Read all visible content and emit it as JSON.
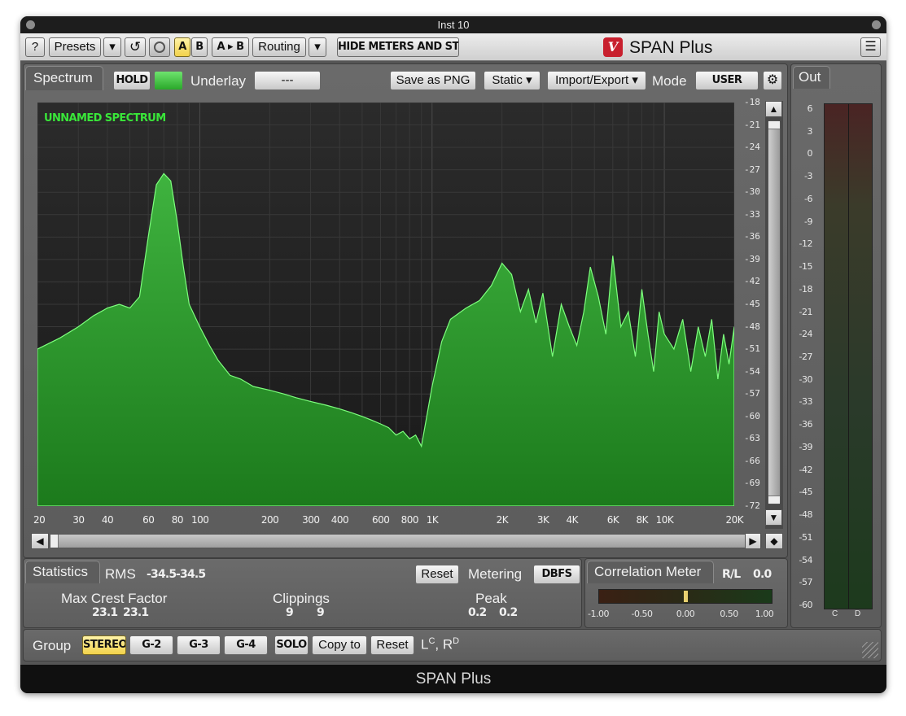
{
  "window": {
    "title": "Inst 10",
    "footer": "SPAN Plus"
  },
  "toolbar": {
    "help": "?",
    "presets": "Presets",
    "dropdown_arrow": "▾",
    "undo": "↺",
    "a": "A",
    "b": "B",
    "a_to_b": "A ▸ B",
    "routing": "Routing",
    "hide_meters": "HIDE METERS AND STATS",
    "brand_logo": "V",
    "brand": "SPAN Plus",
    "menu": "☰"
  },
  "spectrum": {
    "tab": "Spectrum",
    "hold": "HOLD",
    "underlay_label": "Underlay",
    "underlay_value": "---",
    "save_png": "Save as PNG",
    "static": "Static ▾",
    "import_export": "Import/Export ▾",
    "mode_label": "Mode",
    "mode_value": "USER",
    "settings_icon": "⚙",
    "spectrum_name": "UNNAMED SPECTRUM",
    "scroll_up": "▲",
    "scroll_down": "▼",
    "scroll_left": "◀",
    "scroll_right": "▶",
    "scroll_reset": "◆"
  },
  "chart_data": {
    "type": "area",
    "title": "",
    "xlabel": "",
    "ylabel": "",
    "x_scale": "log",
    "xlim": [
      20,
      20000
    ],
    "ylim": [
      -72,
      -18
    ],
    "grid": true,
    "color": "#2f9e2f",
    "x_ticks": [
      "20",
      "30",
      "40",
      "60",
      "80",
      "100",
      "200",
      "300",
      "400",
      "600",
      "800",
      "1K",
      "2K",
      "3K",
      "4K",
      "6K",
      "8K",
      "10K",
      "20K"
    ],
    "y_ticks": [
      "-18",
      "-21",
      "-24",
      "-27",
      "-30",
      "-33",
      "-36",
      "-39",
      "-42",
      "-45",
      "-48",
      "-51",
      "-54",
      "-57",
      "-60",
      "-63",
      "-66",
      "-69",
      "-72"
    ],
    "series": [
      {
        "values_x": [
          20,
          25,
          30,
          35,
          40,
          45,
          50,
          55,
          60,
          65,
          70,
          75,
          80,
          85,
          90,
          100,
          110,
          120,
          135,
          150,
          170,
          200,
          230,
          260,
          300,
          350,
          400,
          450,
          500,
          550,
          600,
          650,
          700,
          750,
          800,
          850,
          900,
          1000,
          1100,
          1200,
          1400,
          1600,
          1800,
          2000,
          2200,
          2400,
          2600,
          2800,
          3000,
          3300,
          3600,
          3900,
          4200,
          4500,
          4800,
          5200,
          5600,
          6000,
          6500,
          7000,
          7500,
          8000,
          8500,
          9000,
          9500,
          10000,
          11000,
          12000,
          13000,
          14000,
          15000,
          16000,
          17000,
          18000,
          19000,
          20000
        ],
        "values": [
          -51,
          -49.5,
          -48,
          -46.5,
          -45.5,
          -45,
          -45.5,
          -44,
          -36,
          -29,
          -27.5,
          -28.5,
          -34,
          -40,
          -45,
          -48,
          -50.5,
          -52.5,
          -54.5,
          -55,
          -56,
          -56.5,
          -57,
          -57.5,
          -58,
          -58.5,
          -59,
          -59.5,
          -60,
          -60.5,
          -61,
          -61.5,
          -62.5,
          -62,
          -63,
          -62.5,
          -64,
          -56,
          -50,
          -47,
          -45.5,
          -44.5,
          -42.5,
          -39.5,
          -41,
          -46,
          -43,
          -47.5,
          -43.5,
          -52,
          -45,
          -48,
          -50.5,
          -46,
          -40,
          -44,
          -49,
          -38.5,
          -48,
          -46,
          -52,
          -43,
          -49,
          -54,
          -46,
          -49,
          -51,
          -47,
          -54,
          -48,
          -52,
          -47,
          -55,
          -49,
          -53,
          -48
        ]
      }
    ]
  },
  "statistics": {
    "tab": "Statistics",
    "rms_label": "RMS",
    "rms_l": "-34.5",
    "rms_r": "-34.5",
    "reset": "Reset",
    "metering_label": "Metering",
    "metering_value": "DBFS",
    "crest_label": "Max Crest Factor",
    "crest_l": "23.1",
    "crest_r": "23.1",
    "clip_label": "Clippings",
    "clip_l": "9",
    "clip_r": "9",
    "peak_label": "Peak",
    "peak_l": "0.2",
    "peak_r": "0.2"
  },
  "correlation": {
    "tab": "Correlation Meter",
    "channel": "R/L",
    "value": "0.0",
    "level": 0.0,
    "ticks": [
      "-1.00",
      "-0.50",
      "0.00",
      "0.50",
      "1.00"
    ]
  },
  "out": {
    "tab": "Out",
    "scale": [
      "6",
      "3",
      "0",
      "-3",
      "-6",
      "-9",
      "-12",
      "-15",
      "-18",
      "-21",
      "-24",
      "-27",
      "-30",
      "-33",
      "-36",
      "-39",
      "-42",
      "-45",
      "-48",
      "-51",
      "-54",
      "-57",
      "-60"
    ],
    "channels": [
      "C",
      "D"
    ]
  },
  "group": {
    "label": "Group",
    "stereo": "STEREO",
    "g2": "G-2",
    "g3": "G-3",
    "g4": "G-4",
    "solo": "SOLO",
    "copy_to": "Copy to",
    "reset": "Reset",
    "routing_l": "L",
    "routing_l_sup": "C",
    "routing_sep": ", R",
    "routing_r_sup": "D"
  }
}
